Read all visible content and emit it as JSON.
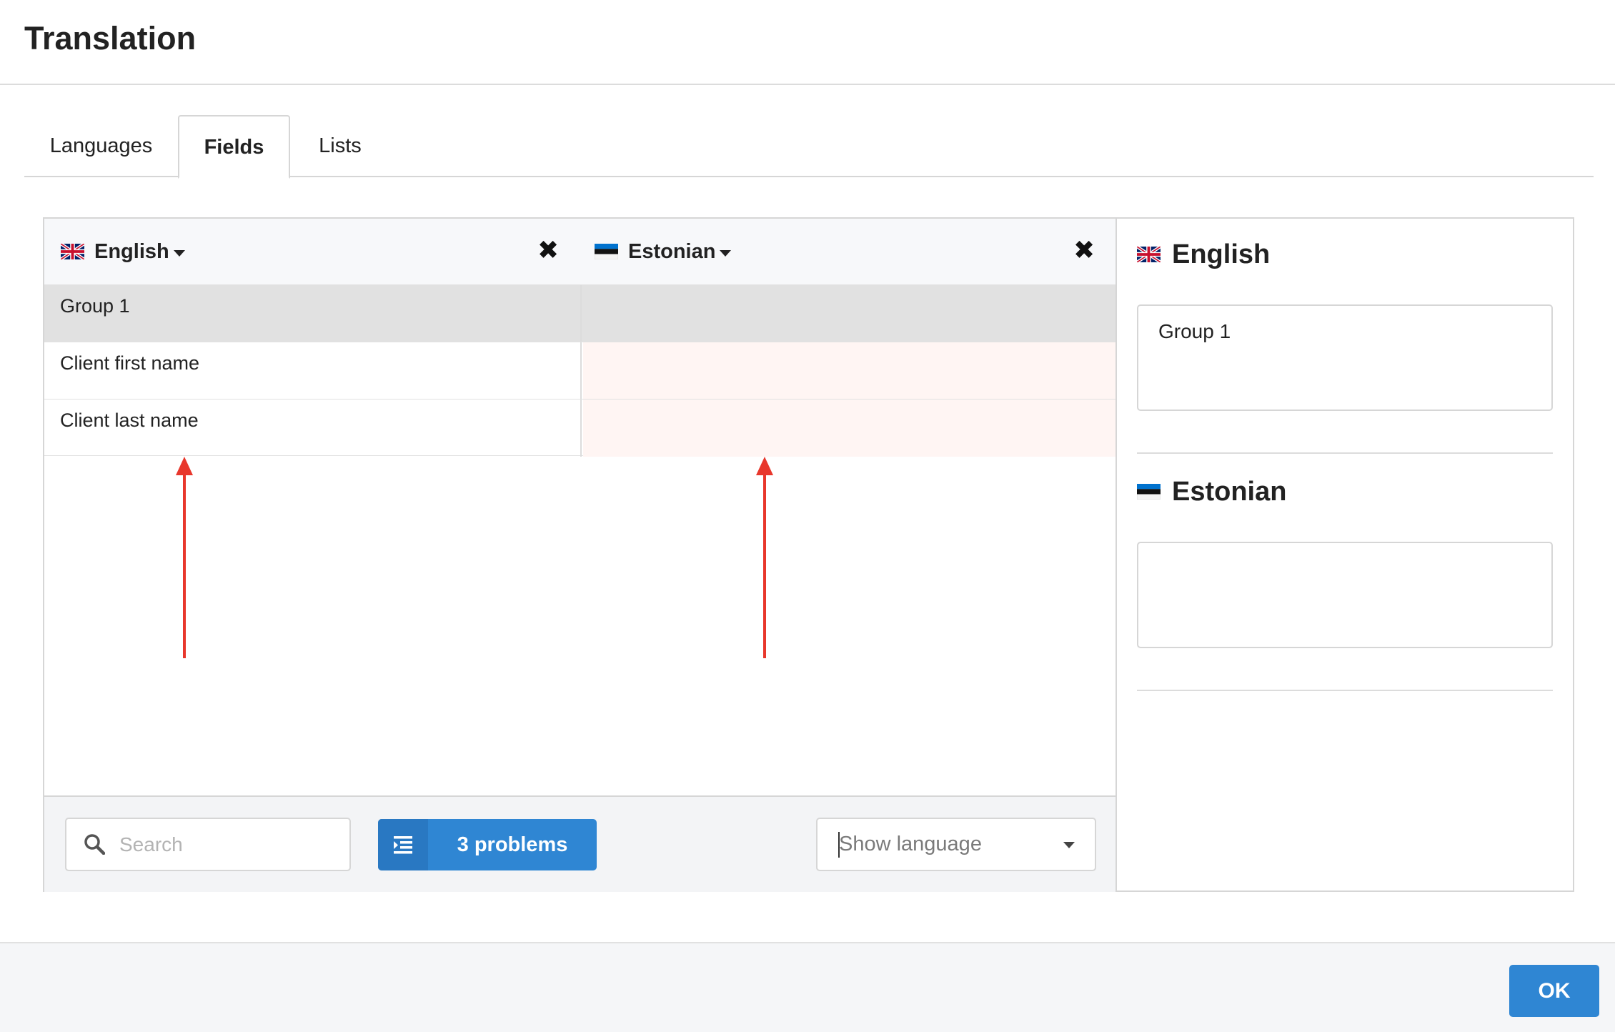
{
  "window": {
    "title": "Translation"
  },
  "tabs": [
    {
      "label": "Languages",
      "active": false
    },
    {
      "label": "Fields",
      "active": true
    },
    {
      "label": "Lists",
      "active": false
    }
  ],
  "grid": {
    "columns": [
      {
        "language": "English",
        "flag": "uk-flag-icon"
      },
      {
        "language": "Estonian",
        "flag": "estonia-flag-icon"
      }
    ],
    "rows": [
      {
        "source": "Group 1",
        "translation": "",
        "type": "group"
      },
      {
        "source": "Client first name",
        "translation": "",
        "type": "missing"
      },
      {
        "source": "Client last name",
        "translation": "",
        "type": "missing"
      }
    ]
  },
  "footer": {
    "search_placeholder": "Search",
    "problems_label": "3 problems",
    "show_language_placeholder": "Show language"
  },
  "side_panel": {
    "source_language": "English",
    "source_text": "Group 1",
    "target_language": "Estonian",
    "target_text": ""
  },
  "actions": {
    "ok_label": "OK"
  },
  "colors": {
    "accent": "#2f86d3",
    "missing_translation_bg": "#fff5f3",
    "group_row_bg": "#e1e1e1",
    "annotation_arrow": "#e8372c"
  }
}
